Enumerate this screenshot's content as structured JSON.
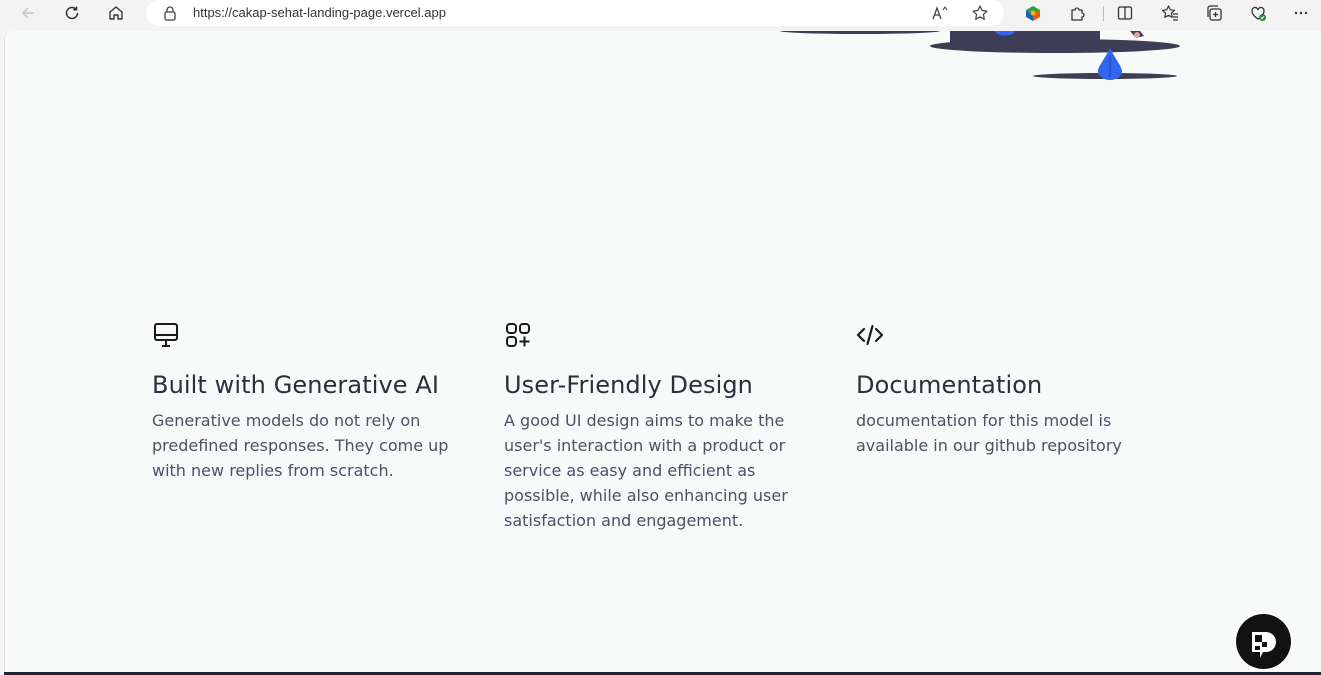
{
  "browser": {
    "url": "https://cakap-sehat-landing-page.vercel.app",
    "icons": [
      "back-icon",
      "refresh-icon",
      "home-icon",
      "lock-icon",
      "read-aloud-icon",
      "favorite-star-icon",
      "extension-colorful-icon",
      "extensions-puzzle-icon",
      "split-screen-icon",
      "favorites-icon",
      "collections-icon",
      "browser-essentials-icon",
      "more-icon"
    ]
  },
  "features": [
    {
      "icon": "monitor-icon",
      "title": "Built with Generative AI",
      "description": "Generative models do not rely on predefined responses. They come up with new replies from scratch."
    },
    {
      "icon": "apps-add-icon",
      "title": "User-Friendly Design",
      "description": "A good UI design aims to make the user's interaction with a product or service as easy and efficient as possible, while also enhancing user satisfaction and engagement."
    },
    {
      "icon": "code-icon",
      "title": "Documentation",
      "description": "documentation for this model is available in our github repository"
    }
  ],
  "colors": {
    "page_background": "#f8fafa",
    "heading": "#2b2f3a",
    "body_text": "#4a5263",
    "illustration_dark": "#3f3d56",
    "illustration_accent": "#3366ee"
  }
}
